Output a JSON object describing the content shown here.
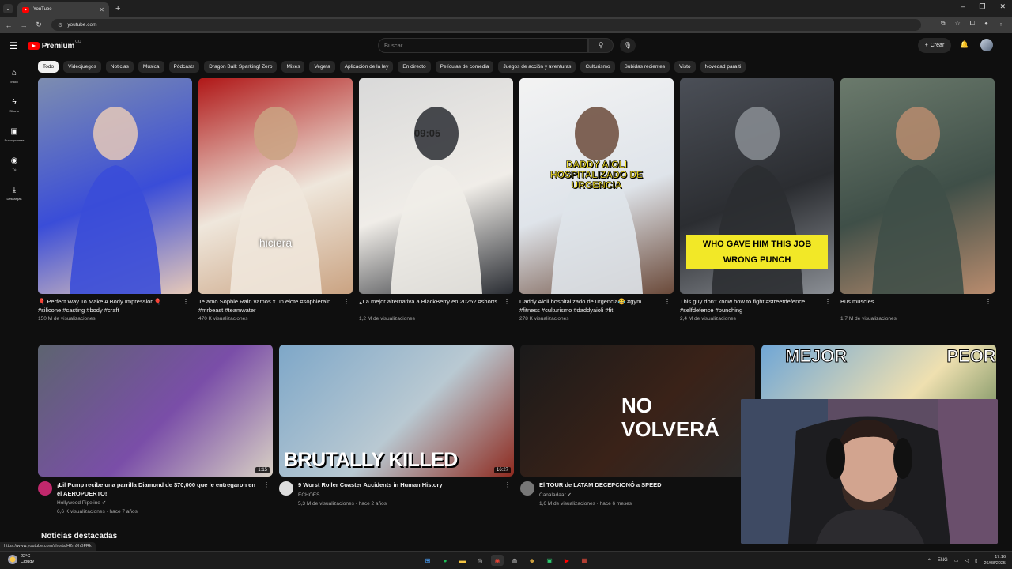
{
  "browser": {
    "tab_title": "YouTube",
    "url": "youtube.com"
  },
  "header": {
    "logo_text": "Premium",
    "logo_sup": "CO",
    "search_placeholder": "Buscar",
    "create_label": "Crear"
  },
  "sidebar": [
    {
      "label": "Inicio",
      "icon": "home-icon",
      "glyph": "⌂"
    },
    {
      "label": "Shorts",
      "icon": "shorts-icon",
      "glyph": "ϟ"
    },
    {
      "label": "Suscripciones",
      "icon": "subscriptions-icon",
      "glyph": "▣"
    },
    {
      "label": "Tú",
      "icon": "you-icon",
      "glyph": "◉"
    },
    {
      "label": "Descargas",
      "icon": "download-icon",
      "glyph": "⤓"
    }
  ],
  "chips": [
    "Todo",
    "Videojuegos",
    "Noticias",
    "Música",
    "Pódcasts",
    "Dragon Ball: Sparking! Zero",
    "Mixes",
    "Vegeta",
    "Aplicación de la ley",
    "En directo",
    "Películas de comedia",
    "Juegos de acción y aventuras",
    "Culturismo",
    "Subidas recientes",
    "Visto",
    "Novedad para ti"
  ],
  "shorts": [
    {
      "title": "🎈 Perfect Way To Make A Body Impression🎈 #silicone #casting #body #craft",
      "views": "150 M de visualizaciones",
      "overlay": "",
      "colors": [
        "#7d8db0",
        "#3a4dd8",
        "#e6c9b8"
      ]
    },
    {
      "title": "Te amo Sophie Rain vamos x un elote #sophierain #mrbeast #teamwater",
      "views": "470 K visualizaciones",
      "overlay": "hiciera",
      "colors": [
        "#b01818",
        "#efe7dc",
        "#caa382"
      ]
    },
    {
      "title": "¿La mejor alternativa a BlackBerry en 2025? #shorts",
      "views": "1,2 M de visualizaciones",
      "overlay": "09:05",
      "colors": [
        "#d9d9d9",
        "#f0ede8",
        "#2a2d33"
      ]
    },
    {
      "title": "Daddy Aioli hospitalizado de urgencia😂 #gym #fitness #culturismo #daddyaioli #fit",
      "views": "278 K visualizaciones",
      "overlay": "DADDY AIOLI HOSPITALIZADO DE URGENCIA",
      "colors": [
        "#f3f3f3",
        "#dfe4ea",
        "#6b4a3a"
      ]
    },
    {
      "title": "This guy don't know how to fight #streetdefence #selfdefence #punching",
      "views": "2,4 M de visualizaciones",
      "overlay": "WHO GAVE HIM THIS JOB WRONG PUNCH",
      "colors": [
        "#4b4f57",
        "#2b2d31",
        "#8a8e94"
      ]
    },
    {
      "title": "Bus muscles",
      "views": "1,7 M de visualizaciones",
      "overlay": "",
      "colors": [
        "#6b7a6c",
        "#3f4f48",
        "#b98c6e"
      ]
    }
  ],
  "videos": [
    {
      "title": "¡Lil Pump recibe una parrilla Diamond de $70,000 que le entregaron en el AEROPUERTO!",
      "channel": "Hollywood Pipeline ✔",
      "meta": "6,6 K visualizaciones · hace 7 años",
      "duration": "1:15",
      "overlay": "",
      "colors": [
        "#5d6470",
        "#7a4ea8",
        "#d8d0c4"
      ],
      "avatar": "#c0286c"
    },
    {
      "title": "9 Worst Roller Coaster Accidents in Human History",
      "channel": "ECHOES",
      "meta": "5,3 M de visualizaciones · hace 2 años",
      "duration": "16:27",
      "overlay": "BRUTALLY KILLED",
      "colors": [
        "#7ea7c8",
        "#b9c9d2",
        "#8e2a1f"
      ],
      "avatar": "#ddd"
    },
    {
      "title": "El TOUR de LATAM DECEPCIONÓ a SPEED",
      "channel": "Canaladaar ✔",
      "meta": "1,6 M de visualizaciones · hace 6 meses",
      "duration": "",
      "overlay": "NO VOLVERÁ",
      "colors": [
        "#1a1a1a",
        "#3a2218",
        "#2b2b2b"
      ],
      "avatar": "#777"
    },
    {
      "title": "",
      "channel": "",
      "meta": "",
      "duration": "",
      "overlay": "MEJOR PEOR",
      "colors": [
        "#6fa6d6",
        "#efe0b0",
        "#3e6a3b"
      ],
      "avatar": "#444"
    }
  ],
  "section_title": "Noticias destacadas",
  "status_url": "https://www.youtube.com/shorts/H2m9hBFRk",
  "taskbar": {
    "temp": "22°C",
    "weather": "Cloudy",
    "lang": "ENG",
    "time": "17:16",
    "date": "26/08/2025"
  }
}
